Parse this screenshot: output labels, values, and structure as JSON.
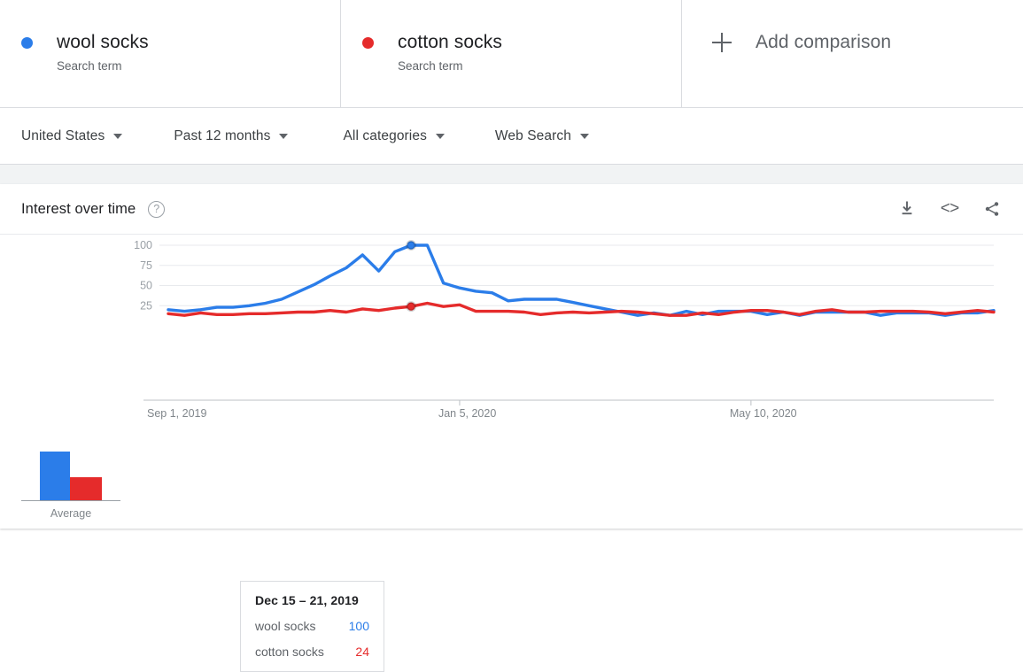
{
  "colors": {
    "wool": "#2b7de9",
    "cotton": "#e52b2b",
    "text_primary": "#202124",
    "text_secondary": "#5f6368",
    "grid": "#e8eaed"
  },
  "terms": [
    {
      "title": "wool socks",
      "subtitle": "Search term",
      "dot_color": "#2b7de9",
      "dot_icon": "blue-dot-icon"
    },
    {
      "title": "cotton socks",
      "subtitle": "Search term",
      "dot_color": "#e52b2b",
      "dot_icon": "red-dot-icon"
    }
  ],
  "add_comparison": {
    "label": "Add comparison",
    "icon": "plus-icon"
  },
  "filters": [
    {
      "label": "United States",
      "icon": "chevron-down-icon"
    },
    {
      "label": "Past 12 months",
      "icon": "chevron-down-icon"
    },
    {
      "label": "All categories",
      "icon": "chevron-down-icon"
    },
    {
      "label": "Web Search",
      "icon": "chevron-down-icon"
    }
  ],
  "card": {
    "title": "Interest over time",
    "help_icon": "help-circle-icon",
    "help_glyph": "?",
    "actions": [
      {
        "name": "download-icon",
        "label": "Download"
      },
      {
        "name": "embed-code-icon",
        "label": "<>"
      },
      {
        "name": "share-icon",
        "label": "Share"
      }
    ]
  },
  "average": {
    "label": "Average",
    "values": [
      {
        "name": "wool socks",
        "value": 55,
        "color": "#2b7de9"
      },
      {
        "name": "cotton socks",
        "value": 26,
        "color": "#e52b2b"
      }
    ]
  },
  "tooltip": {
    "date": "Dec 15 – 21, 2019",
    "rows": [
      {
        "name": "wool socks",
        "value": "100",
        "color": "#2b7de9"
      },
      {
        "name": "cotton socks",
        "value": "24",
        "color": "#e52b2b"
      }
    ]
  },
  "chart_data": {
    "type": "line",
    "title": "Interest over time",
    "xlabel": "",
    "ylabel": "",
    "ylim": [
      0,
      108
    ],
    "yticks": [
      25,
      50,
      75,
      100
    ],
    "ytick_labels": [
      "25",
      "50",
      "75",
      "100"
    ],
    "grid": true,
    "legend_position": "top",
    "xtick_labels": [
      "Sep 1, 2019",
      "Jan 5, 2020",
      "May 10, 2020"
    ],
    "xtick_indices": [
      0,
      18,
      36
    ],
    "highlight_index": 15,
    "x": [
      "Sep 1, 2019",
      "Sep 8, 2019",
      "Sep 15, 2019",
      "Sep 22, 2019",
      "Sep 29, 2019",
      "Oct 6, 2019",
      "Oct 13, 2019",
      "Oct 20, 2019",
      "Oct 27, 2019",
      "Nov 3, 2019",
      "Nov 10, 2019",
      "Nov 17, 2019",
      "Nov 24, 2019",
      "Dec 1, 2019",
      "Dec 8, 2019",
      "Dec 15, 2019",
      "Dec 22, 2019",
      "Dec 29, 2019",
      "Jan 5, 2020",
      "Jan 12, 2020",
      "Jan 19, 2020",
      "Jan 26, 2020",
      "Feb 2, 2020",
      "Feb 9, 2020",
      "Feb 16, 2020",
      "Feb 23, 2020",
      "Mar 1, 2020",
      "Mar 8, 2020",
      "Mar 15, 2020",
      "Mar 22, 2020",
      "Mar 29, 2020",
      "Apr 5, 2020",
      "Apr 12, 2020",
      "Apr 19, 2020",
      "Apr 26, 2020",
      "May 3, 2020",
      "May 10, 2020",
      "May 17, 2020",
      "May 24, 2020",
      "May 31, 2020",
      "Jun 7, 2020",
      "Jun 14, 2020",
      "Jun 21, 2020",
      "Jun 28, 2020",
      "Jul 5, 2020",
      "Jul 12, 2020",
      "Jul 19, 2020",
      "Jul 26, 2020",
      "Aug 2, 2020",
      "Aug 9, 2020",
      "Aug 16, 2020",
      "Aug 23, 2020"
    ],
    "series": [
      {
        "name": "wool socks",
        "color": "#2b7de9",
        "values": [
          20,
          18,
          20,
          23,
          23,
          25,
          28,
          33,
          42,
          51,
          62,
          72,
          88,
          68,
          92,
          100,
          100,
          53,
          47,
          43,
          41,
          31,
          33,
          33,
          33,
          29,
          25,
          21,
          17,
          13,
          16,
          13,
          18,
          14,
          18,
          18,
          18,
          14,
          17,
          13,
          17,
          17,
          17,
          17,
          13,
          16,
          16,
          16,
          13,
          16,
          16,
          19
        ]
      },
      {
        "name": "cotton socks",
        "color": "#e52b2b",
        "values": [
          15,
          13,
          16,
          14,
          14,
          15,
          15,
          16,
          17,
          17,
          19,
          17,
          21,
          19,
          22,
          24,
          28,
          24,
          26,
          18,
          18,
          18,
          17,
          14,
          16,
          17,
          16,
          17,
          18,
          17,
          15,
          13,
          13,
          16,
          14,
          17,
          19,
          19,
          17,
          14,
          18,
          20,
          17,
          17,
          18,
          18,
          18,
          17,
          15,
          17,
          19,
          17
        ]
      }
    ]
  }
}
